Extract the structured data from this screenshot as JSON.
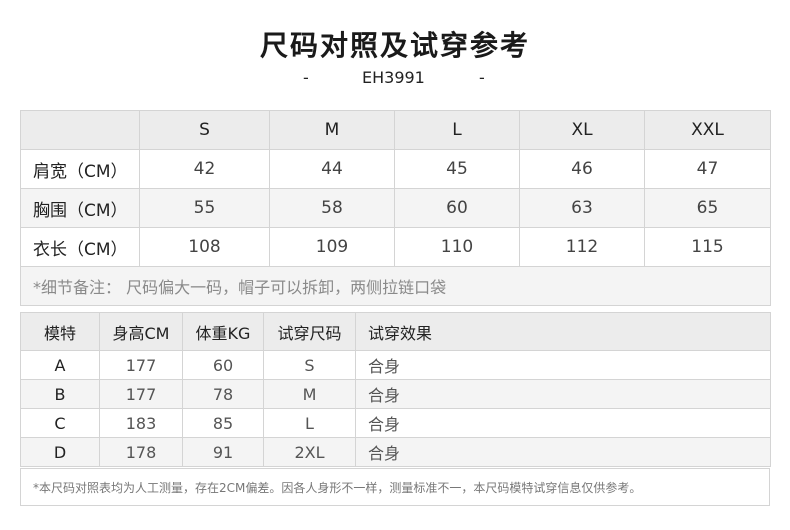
{
  "title": "尺码对照及试穿参考",
  "subtitle": {
    "dash_left": "-",
    "code": "EH3991",
    "dash_right": "-"
  },
  "size_table": {
    "headers": [
      "",
      "S",
      "M",
      "L",
      "XL",
      "XXL"
    ],
    "rows": [
      {
        "label": "肩宽（CM）",
        "values": [
          "42",
          "44",
          "45",
          "46",
          "47"
        ]
      },
      {
        "label": "胸围（CM）",
        "values": [
          "55",
          "58",
          "60",
          "63",
          "65"
        ]
      },
      {
        "label": "衣长（CM）",
        "values": [
          "108",
          "109",
          "110",
          "112",
          "115"
        ]
      }
    ],
    "note": "*细节备注：  尺码偏大一码，帽子可以拆卸，两侧拉链口袋"
  },
  "model_table": {
    "headers": [
      "模特",
      "身高CM",
      "体重KG",
      "试穿尺码",
      "试穿效果"
    ],
    "rows": [
      {
        "model": "A",
        "height": "177",
        "weight": "60",
        "size": "S",
        "effect": "合身"
      },
      {
        "model": "B",
        "height": "177",
        "weight": "78",
        "size": "M",
        "effect": "合身"
      },
      {
        "model": "C",
        "height": "183",
        "weight": "85",
        "size": "L",
        "effect": "合身"
      },
      {
        "model": "D",
        "height": "178",
        "weight": "91",
        "size": "2XL",
        "effect": "合身"
      }
    ]
  },
  "footnote": "*本尺码对照表均为人工测量，存在2CM偏差。因各人身形不一样，测量标准不一，本尺码模特试穿信息仅供参考。",
  "colors": {
    "header_bg": "#ececec",
    "alt_row_bg": "#f4f4f4",
    "border": "#d4d4d4"
  }
}
